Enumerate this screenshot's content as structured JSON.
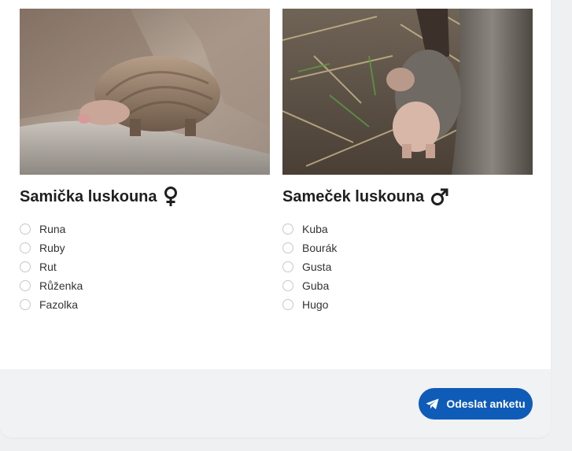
{
  "colors": {
    "accent": "#0f5cb8",
    "footer_bg": "#f1f2f4",
    "radio_border": "#c8c8c8"
  },
  "female": {
    "title": "Samička luskouna",
    "symbol_icon": "female-symbol-icon",
    "image": "pangolin-female-photo",
    "options": [
      "Runa",
      "Ruby",
      "Rut",
      "Růženka",
      "Fazolka"
    ]
  },
  "male": {
    "title": "Sameček luskouna",
    "symbol_icon": "male-symbol-icon",
    "image": "pangolin-male-photo",
    "options": [
      "Kuba",
      "Bourák",
      "Gusta",
      "Guba",
      "Hugo"
    ]
  },
  "submit": {
    "label": "Odeslat anketu",
    "icon": "paper-plane-icon"
  }
}
